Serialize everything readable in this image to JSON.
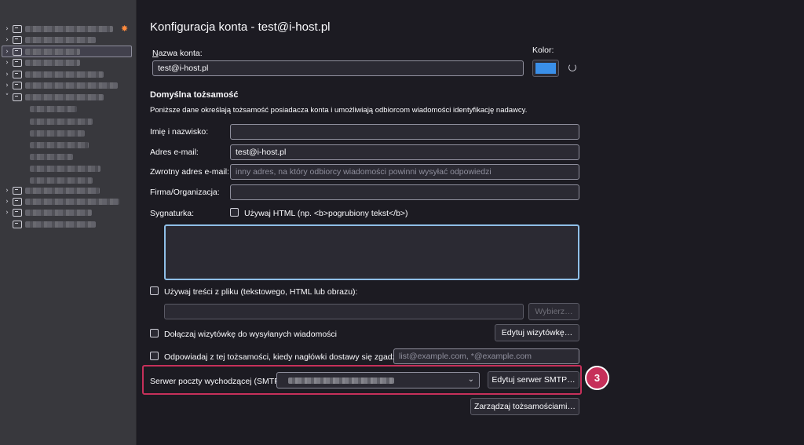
{
  "colors": {
    "accent_color": "#3a8fe8",
    "highlight_border": "#c6305a"
  },
  "page": {
    "title": "Konfiguracja konta - test@i-host.pl"
  },
  "account": {
    "name_label_u": "N",
    "name_label_rest": "azwa konta:",
    "name_value": "test@i-host.pl",
    "color_label": "Kolor:"
  },
  "identity": {
    "heading": "Domyślna tożsamość",
    "description": "Poniższe dane określają tożsamość posiadacza konta i umożliwiają odbiorcom wiadomości identyfikację nadawcy.",
    "fullname_label": "Imię i nazwisko:",
    "fullname_value": "",
    "email_label": "Adres e-mail:",
    "email_value": "test@i-host.pl",
    "reply_label": "Zwrotny adres e-mail:",
    "reply_placeholder": "inny adres, na który odbiorcy wiadomości powinni wysyłać odpowiedzi",
    "org_label": "Firma/Organizacja:",
    "org_value": "",
    "signature_label": "Sygnaturka:",
    "use_html_label": "Używaj HTML (np. <b>pogrubiony tekst</b>)"
  },
  "options": {
    "use_file_label": "Używaj treści z pliku (tekstowego, HTML lub obrazu):",
    "choose_button": "Wybierz…",
    "attach_vcard_label": "Dołączaj wizytówkę do wysyłanych wiadomości",
    "edit_vcard_button": "Edytuj wizytówkę…",
    "reply_from_label": "Odpowiadaj z tej tożsamości, kiedy nagłówki dostawy się zgadzają:",
    "reply_from_placeholder": "list@example.com, *@example.com"
  },
  "smtp": {
    "label": "Serwer poczty wychodzącej (SMTP):",
    "edit_button": "Edytuj serwer SMTP…",
    "badge": "3"
  },
  "footer": {
    "manage_button": "Zarządzaj tożsamościami…"
  }
}
